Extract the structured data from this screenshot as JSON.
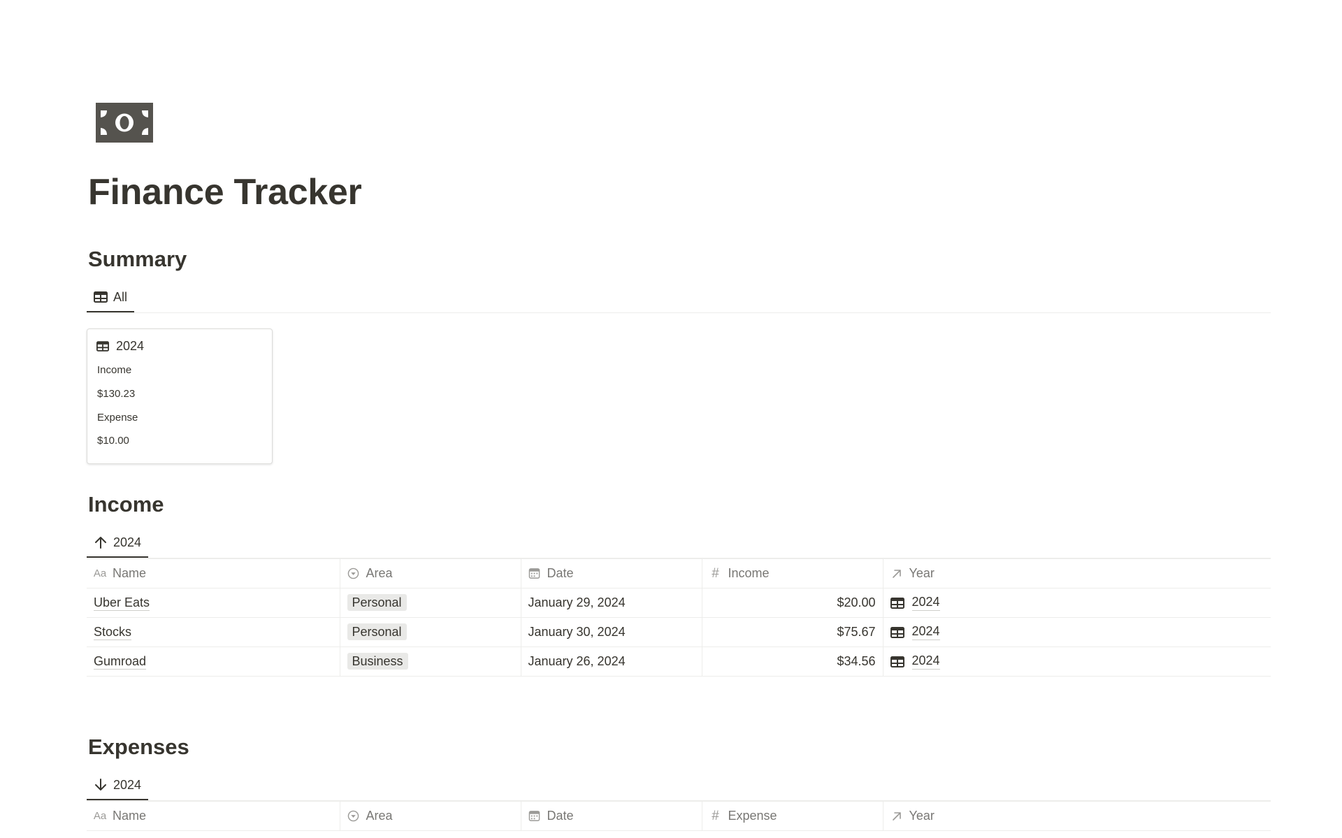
{
  "page": {
    "title": "Finance Tracker",
    "icon": "money-bill-icon"
  },
  "summary": {
    "heading": "Summary",
    "view_tab": "All",
    "card": {
      "title": "2024",
      "income_label": "Income",
      "income_value": "$130.23",
      "expense_label": "Expense",
      "expense_value": "$10.00"
    }
  },
  "income": {
    "heading": "Income",
    "view_tab": "2024",
    "columns": [
      "Name",
      "Area",
      "Date",
      "Income",
      "Year"
    ],
    "rows": [
      {
        "name": "Uber Eats",
        "area": "Personal",
        "date": "January 29, 2024",
        "amount": "$20.00",
        "year": "2024"
      },
      {
        "name": "Stocks",
        "area": "Personal",
        "date": "January 30, 2024",
        "amount": "$75.67",
        "year": "2024"
      },
      {
        "name": "Gumroad",
        "area": "Business",
        "date": "January 26, 2024",
        "amount": "$34.56",
        "year": "2024"
      }
    ]
  },
  "expenses": {
    "heading": "Expenses",
    "view_tab": "2024",
    "columns": [
      "Name",
      "Area",
      "Date",
      "Expense",
      "Year"
    ]
  },
  "colors": {
    "text": "#37352f",
    "muted": "#787774",
    "border": "#ededeb",
    "tag_bg": "#e9e9e7",
    "icon": "#55534e"
  }
}
